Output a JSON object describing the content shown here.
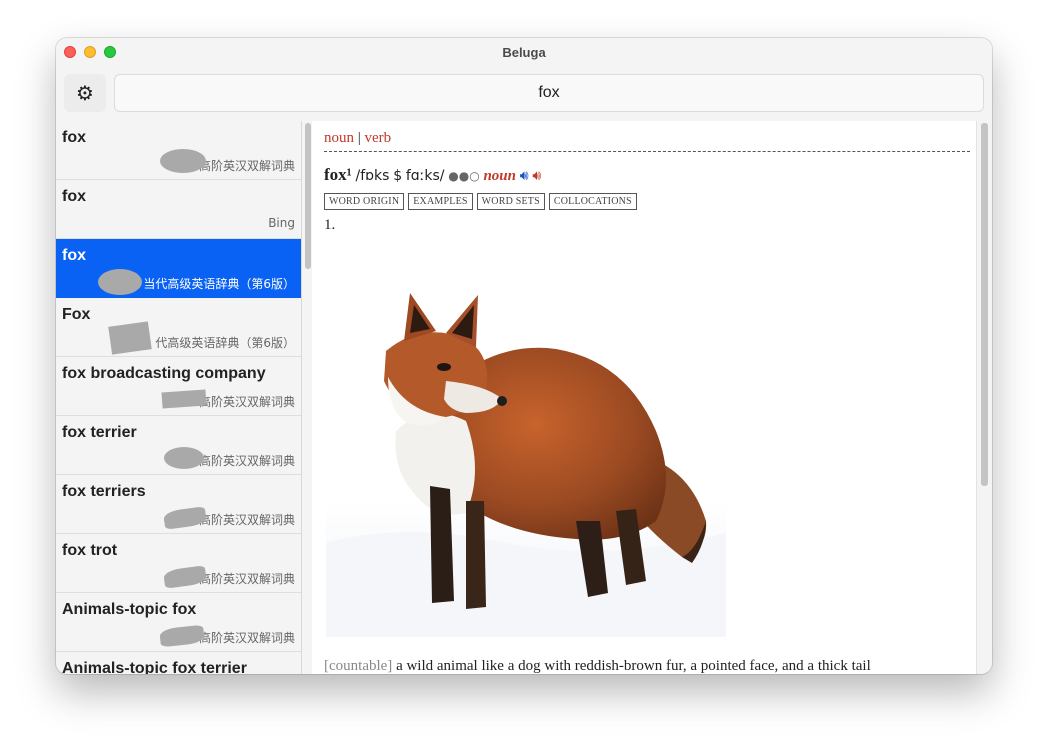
{
  "window": {
    "title": "Beluga"
  },
  "toolbar": {
    "gear_icon": "⚙",
    "search_value": "fox"
  },
  "results": [
    {
      "title": "fox",
      "source": "高阶英汉双解词典"
    },
    {
      "title": "fox",
      "source": "Bing"
    },
    {
      "title": "fox",
      "source": "当代高级英语辞典（第6版）"
    },
    {
      "title": "Fox",
      "source": "代高级英语辞典（第6版）"
    },
    {
      "title": "fox broadcasting company",
      "source": "高阶英汉双解词典"
    },
    {
      "title": "fox terrier",
      "source": "高阶英汉双解词典"
    },
    {
      "title": "fox terriers",
      "source": "高阶英汉双解词典"
    },
    {
      "title": "fox trot",
      "source": "高阶英汉双解词典"
    },
    {
      "title": "Animals-topic fox",
      "source": "高阶英汉双解词典"
    },
    {
      "title": "Animals-topic fox terrier",
      "source": ""
    }
  ],
  "entry": {
    "pos_links": [
      "noun",
      "verb"
    ],
    "separator": "|",
    "headword": "fox¹",
    "pron_uk": "/fɒks",
    "pron_us_marker": "$",
    "pron_us": "fɑːks/",
    "frequency": "●●○",
    "pos": "noun",
    "tabs": [
      "WORD ORIGIN",
      "EXAMPLES",
      "WORD SETS",
      "COLLOCATIONS"
    ],
    "sense_number": "1.",
    "definition_label": "[countable]",
    "definition": "a wild animal like a dog with reddish-brown fur, a pointed face, and a thick tail"
  },
  "colors": {
    "selected": "#0a62f5",
    "entry_red": "#c0392b"
  }
}
